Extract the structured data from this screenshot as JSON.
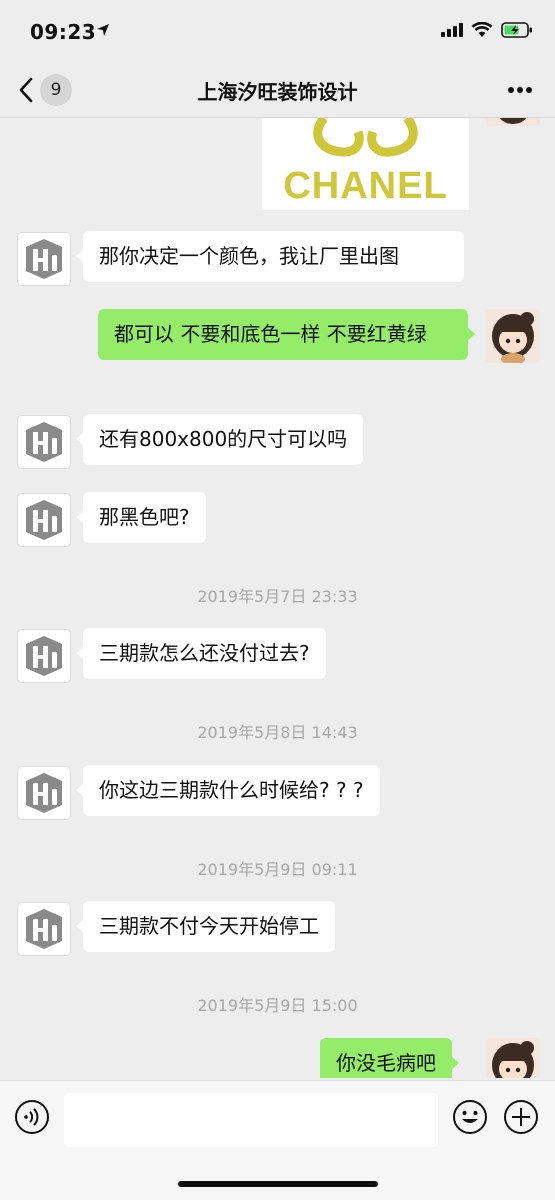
{
  "status_bar": {
    "time": "09:23"
  },
  "nav": {
    "back_count": "9",
    "title": "上海汐旺装饰设计"
  },
  "image_message": {
    "brand_text": "CHANEL"
  },
  "messages": [
    {
      "side": "left",
      "text": "那你决定一个颜色，我让厂里出图"
    },
    {
      "side": "right",
      "text": "都可以 不要和底色一样 不要红黄绿"
    },
    {
      "side": "left",
      "text": "还有800x800的尺寸可以吗"
    },
    {
      "side": "left",
      "text": "那黑色吧?"
    },
    {
      "side": "left",
      "text": "三期款怎么还没付过去?"
    },
    {
      "side": "left",
      "text": "你这边三期款什么时候给? ? ?"
    },
    {
      "side": "left",
      "text": "三期款不付今天开始停工"
    },
    {
      "side": "right",
      "text": "你没毛病吧"
    }
  ],
  "timestamps": [
    "2019年5月7日 23:33",
    "2019年5月8日 14:43",
    "2019年5月9日 09:11",
    "2019年5月9日 15:00"
  ],
  "input": {
    "placeholder": ""
  },
  "colors": {
    "sent_bubble": "#95ec69",
    "received_bubble": "#ffffff",
    "background": "#ededed",
    "timestamp": "#a8a8a8"
  }
}
